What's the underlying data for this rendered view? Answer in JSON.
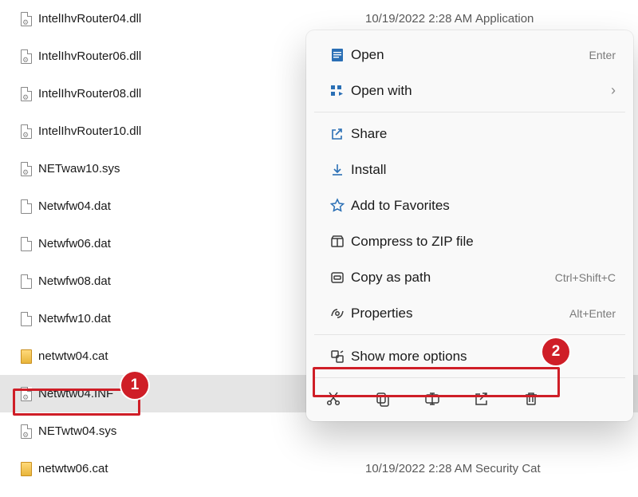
{
  "files": [
    {
      "name": "IntelIhvRouter04.dll",
      "date": "10/19/2022 2:28 AM",
      "type": "Application",
      "icon": "dll"
    },
    {
      "name": "IntelIhvRouter06.dll",
      "date": "",
      "type": "",
      "icon": "dll"
    },
    {
      "name": "IntelIhvRouter08.dll",
      "date": "",
      "type": "",
      "icon": "dll"
    },
    {
      "name": "IntelIhvRouter10.dll",
      "date": "",
      "type": "",
      "icon": "dll"
    },
    {
      "name": "NETwaw10.sys",
      "date": "",
      "type": "",
      "icon": "sys"
    },
    {
      "name": "Netwfw04.dat",
      "date": "",
      "type": "",
      "icon": "dat"
    },
    {
      "name": "Netwfw06.dat",
      "date": "",
      "type": "",
      "icon": "dat"
    },
    {
      "name": "Netwfw08.dat",
      "date": "",
      "type": "",
      "icon": "dat"
    },
    {
      "name": "Netwfw10.dat",
      "date": "",
      "type": "",
      "icon": "dat"
    },
    {
      "name": "netwtw04.cat",
      "date": "",
      "type": "",
      "icon": "cat"
    },
    {
      "name": "Netwtw04.INF",
      "date": "",
      "type": "",
      "icon": "inf",
      "selected": true
    },
    {
      "name": "NETwtw04.sys",
      "date": "",
      "type": "",
      "icon": "sys"
    },
    {
      "name": "netwtw06.cat",
      "date": "10/19/2022 2:28 AM",
      "type": "Security Cat",
      "icon": "cat"
    }
  ],
  "menu": {
    "open": {
      "label": "Open",
      "accel": "Enter"
    },
    "openwith": {
      "label": "Open with"
    },
    "share": {
      "label": "Share"
    },
    "install": {
      "label": "Install"
    },
    "fav": {
      "label": "Add to Favorites"
    },
    "zip": {
      "label": "Compress to ZIP file"
    },
    "copypath": {
      "label": "Copy as path",
      "accel": "Ctrl+Shift+C"
    },
    "props": {
      "label": "Properties",
      "accel": "Alt+Enter"
    },
    "more": {
      "label": "Show more options"
    }
  },
  "callouts": {
    "one": "1",
    "two": "2"
  }
}
